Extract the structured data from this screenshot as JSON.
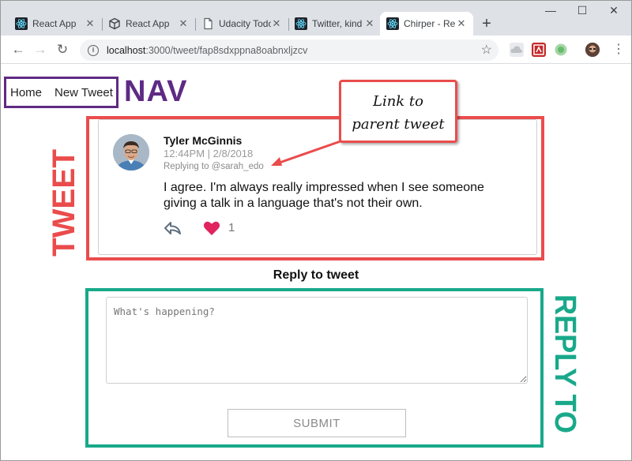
{
  "browser": {
    "tabs": [
      {
        "title": "React App",
        "icon": "react-icon",
        "active": false
      },
      {
        "title": "React App",
        "icon": "cube-icon",
        "active": false
      },
      {
        "title": "Udacity Todo",
        "icon": "page-icon",
        "active": false
      },
      {
        "title": "Twitter, kind",
        "icon": "react-icon",
        "active": false
      },
      {
        "title": "Chirper - Re",
        "icon": "react-icon",
        "active": true
      }
    ],
    "new_tab_label": "+",
    "window_controls": {
      "minimize": "—",
      "maximize": "☐",
      "close": "✕"
    },
    "url_host": "localhost",
    "url_path": ":3000/tweet/fap8sdxppna8oabnxljzcv"
  },
  "nav": {
    "home_label": "Home",
    "new_tweet_label": "New Tweet"
  },
  "annotations": {
    "nav": "NAV",
    "tweet": "TWEET",
    "reply": "REPLY TO",
    "callout_line1": "Link to",
    "callout_line2": "parent tweet",
    "nav_color": "#5e2a84",
    "tweet_color": "#ea4c4c",
    "reply_color": "#18a98a"
  },
  "tweet": {
    "author": "Tyler McGinnis",
    "timestamp": "12:44PM | 2/8/2018",
    "replying_prefix": "Replying to ",
    "replying_to": "@sarah_edo",
    "text": "I agree. I'm always really impressed when I see someone giving a talk in a language that's not their own.",
    "likes": "1",
    "liked": true,
    "like_color": "#e0245e"
  },
  "reply": {
    "title": "Reply to tweet",
    "placeholder": "What's happening?",
    "value": "",
    "submit_label": "SUBMIT"
  }
}
